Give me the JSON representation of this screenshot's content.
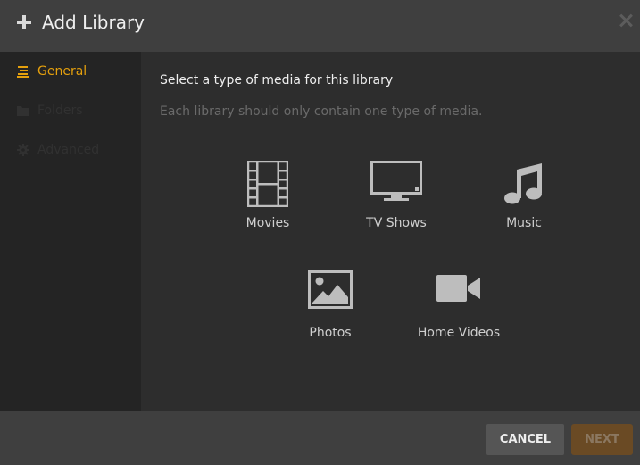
{
  "header": {
    "title": "Add Library",
    "plus_icon": "plus-icon",
    "close_icon": "close-icon"
  },
  "sidebar": {
    "items": [
      {
        "label": "General",
        "icon": "list-icon",
        "active": true
      },
      {
        "label": "Folders",
        "icon": "folder-icon",
        "active": false
      },
      {
        "label": "Advanced",
        "icon": "gear-icon",
        "active": false
      }
    ]
  },
  "main": {
    "title": "Select a type of media for this library",
    "subtitle": "Each library should only contain one type of media.",
    "media_types": [
      {
        "label": "Movies",
        "icon": "film-icon"
      },
      {
        "label": "TV Shows",
        "icon": "tv-icon"
      },
      {
        "label": "Music",
        "icon": "music-note-icon"
      },
      {
        "label": "Photos",
        "icon": "photo-icon"
      },
      {
        "label": "Home Videos",
        "icon": "video-camera-icon"
      }
    ]
  },
  "footer": {
    "cancel_label": "CANCEL",
    "next_label": "NEXT"
  },
  "colors": {
    "accent": "#e5a00d",
    "header_bg": "#3f3f3f",
    "sidebar_bg": "#242424",
    "main_bg": "#2d2d2d",
    "next_disabled_bg": "#6a4a24"
  }
}
